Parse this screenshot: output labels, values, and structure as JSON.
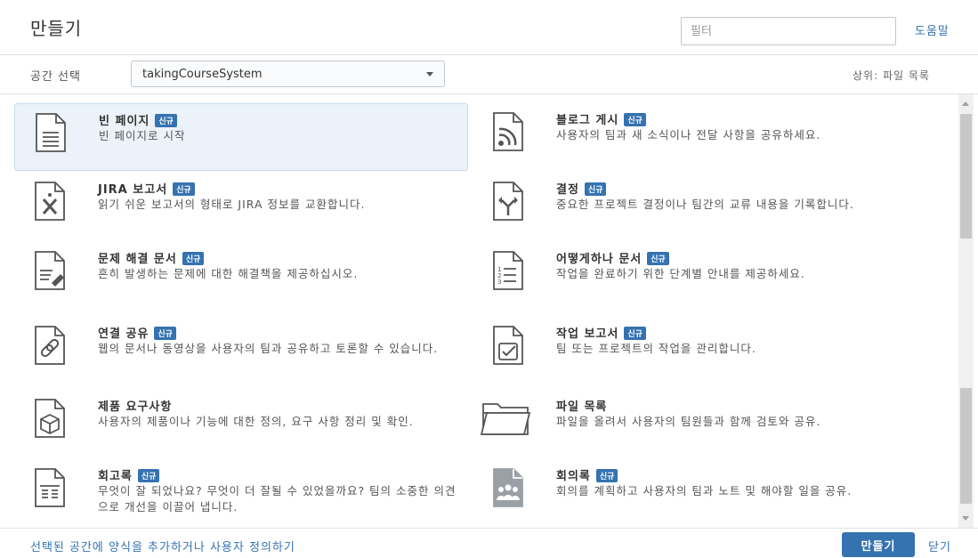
{
  "header": {
    "title": "만들기",
    "filter_placeholder": "필터",
    "help_label": "도움말"
  },
  "space": {
    "label": "공간 선택",
    "selected": "takingCourseSystem",
    "parent": "상위: 파일 목록"
  },
  "badge_label": "신규",
  "items": [
    {
      "title": "빈 페이지",
      "desc": "빈 페이지로 시작",
      "icon": "blank-page-icon"
    },
    {
      "title": "블로그 게시",
      "desc": "사용자의 팀과 새 소식이나 전달 사항을 공유하세요.",
      "icon": "blog-rss-icon"
    },
    {
      "title": "JIRA 보고서",
      "desc": "읽기 쉬운 보고서의 형태로 JIRA 정보를 교환합니다.",
      "icon": "jira-report-icon"
    },
    {
      "title": "결정",
      "desc": "중요한 프로젝트 결정이나 팀간의 교류 내용을 기록합니다.",
      "icon": "decision-icon"
    },
    {
      "title": "문제 해결 문서",
      "desc": "흔히 발생하는 문제에 대한 해결책을 제공하십시오.",
      "icon": "troubleshooting-icon"
    },
    {
      "title": "어떻게하나 문서",
      "desc": "작업을 완료하기 위한 단계별 안내를 제공하세요.",
      "icon": "how-to-list-icon"
    },
    {
      "title": "연결 공유",
      "desc": "웹의 문서나 동영상을 사용자의 팀과 공유하고 토론할 수 있습니다.",
      "icon": "link-share-icon"
    },
    {
      "title": "작업 보고서",
      "desc": "팀 또는 프로젝트의 작업을 관리합니다.",
      "icon": "task-report-icon"
    },
    {
      "title": "제품 요구사항",
      "desc": "사용자의 제품이나 기능에 대한 정의, 요구 사항 정리 및 확인.",
      "icon": "product-requirements-icon"
    },
    {
      "title": "파일 목록",
      "desc": "파일을 올려서 사용자의 팀원들과 함께 검토와 공유.",
      "icon": "file-list-folder-icon"
    },
    {
      "title": "회고록",
      "desc": "무엇이 잘 되었나요? 무엇이 더 잘될 수 있었을까요? 팀의 소중한 의견으로 개선을 이끌어 냅니다.",
      "icon": "retrospective-icon"
    },
    {
      "title": "회의록",
      "desc": "회의를 계획하고 사용자의 팀과 노트 및 해야할 일을 공유.",
      "icon": "meeting-notes-icon"
    }
  ],
  "footer": {
    "customize_link": "선택된 공간에 양식을 추가하거나 사용자 정의하기",
    "create_label": "만들기",
    "close_label": "닫기"
  }
}
